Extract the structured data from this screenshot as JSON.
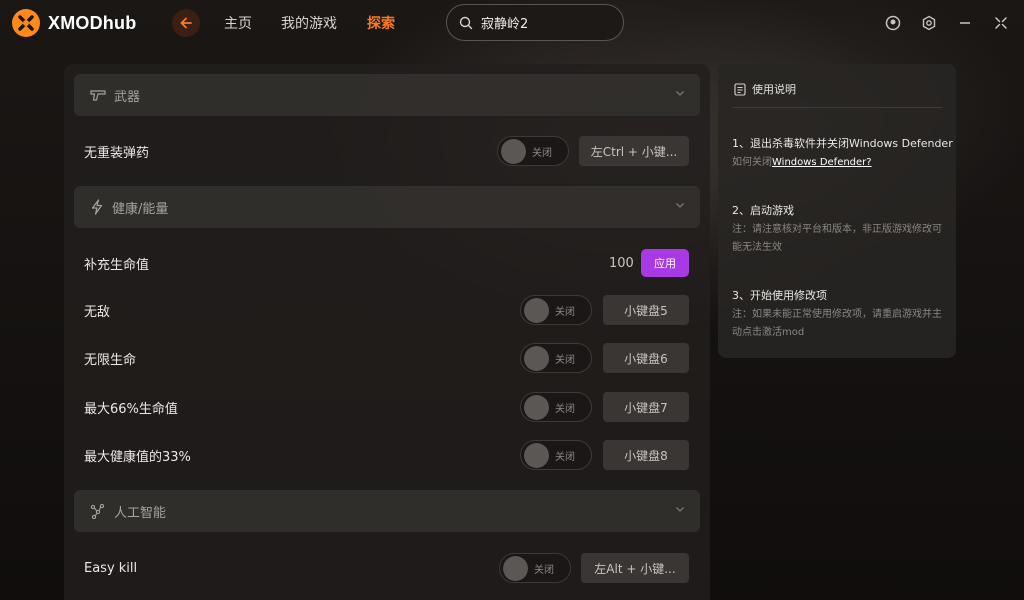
{
  "app": {
    "logo_text": "XMODhub"
  },
  "nav": {
    "home": "主页",
    "my_games": "我的游戏",
    "explore": "探索"
  },
  "search": {
    "value": "寂静岭2"
  },
  "colors": {
    "accent": "#ff7a1a",
    "apply": "#a83ae6"
  },
  "sections": {
    "weapons": {
      "label": "武器",
      "icon": "pistol-icon",
      "rows": [
        {
          "name": "无重装弹药",
          "toggle": "关闭",
          "key": "左Ctrl + 小键..."
        }
      ]
    },
    "health": {
      "label": "健康/能量",
      "icon": "lightning-icon",
      "refill": {
        "name": "补充生命值",
        "value": "100",
        "apply": "应用"
      },
      "rows": [
        {
          "name": "无敌",
          "toggle": "关闭",
          "key": "小键盘5"
        },
        {
          "name": "无限生命",
          "toggle": "关闭",
          "key": "小键盘6"
        },
        {
          "name": "最大66%生命值",
          "toggle": "关闭",
          "key": "小键盘7"
        },
        {
          "name": "最大健康值的33%",
          "toggle": "关闭",
          "key": "小键盘8"
        }
      ]
    },
    "ai": {
      "label": "人工智能",
      "icon": "network-icon",
      "rows": [
        {
          "name": "Easy kill",
          "toggle": "关闭",
          "key": "左Alt + 小键..."
        }
      ]
    }
  },
  "instructions": {
    "title": "使用说明",
    "step1": {
      "title": "1、退出杀毒软件并关闭Windows Defender",
      "note_prefix": "如何关闭",
      "note_link": "Windows Defender?"
    },
    "step2": {
      "title": "2、启动游戏",
      "note": "注：请注意核对平台和版本，非正版游戏修改可能无法生效"
    },
    "step3": {
      "title": "3、开始使用修改项",
      "note": "注：如果未能正常使用修改项，请重启游戏并主动点击激活mod"
    }
  }
}
